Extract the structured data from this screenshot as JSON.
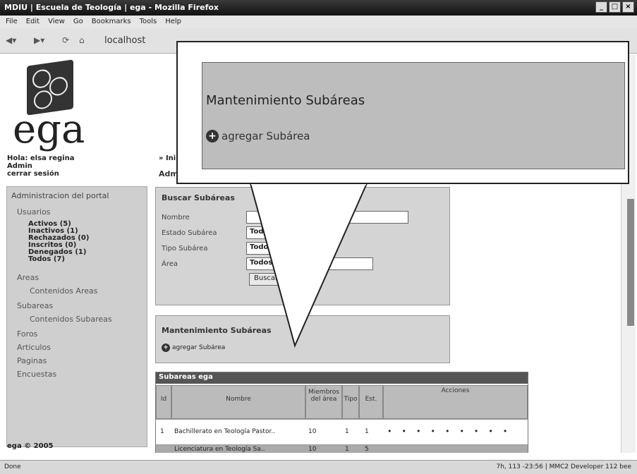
{
  "window": {
    "title": "MDIU | Escuela de Teología | ega - Mozilla Firefox"
  },
  "menu": [
    "File",
    "Edit",
    "View",
    "Go",
    "Bookmarks",
    "Tools",
    "Help"
  ],
  "nav": {
    "url": "localhost"
  },
  "logo": {
    "text": "ega"
  },
  "user": {
    "greeting": "Hola: elsa regina",
    "role": "Admin",
    "logout": "cerrar sesión"
  },
  "breadcrumb": "» Ini",
  "breadcrumb_section": "Adm",
  "sidebar": {
    "heading": "Administracion del portal",
    "usuarios": "Usuarios",
    "user_counts": [
      "Activos (5)",
      "Inactivos (1)",
      "Rechazados (0)",
      "Inscritos (0)",
      "Denegados (1)",
      "Todos (7)"
    ],
    "areas": "Areas",
    "contenidos_areas": "Contenidos Areas",
    "subareas": "Subareas",
    "contenidos_subareas": "Contenidos Subareas",
    "foros": "Foros",
    "articulos": "Articulos",
    "paginas": "Paginas",
    "encuestas": "Encuestas"
  },
  "search": {
    "title": "Buscar Subáreas",
    "fields": [
      "Nombre",
      "Estado Subárea",
      "Tipo Subárea",
      "Área"
    ],
    "selects": [
      "Todos",
      "Todos",
      "Todos"
    ],
    "button": "Buscar"
  },
  "maint": {
    "title": "Mantenimiento Subáreas",
    "add": "agregar Subárea"
  },
  "grid": {
    "title": "Subareas ega",
    "headers": [
      "Id",
      "Nombre",
      "Miembros del área",
      "Tipo",
      "Est.",
      "Acciones"
    ],
    "rows": [
      {
        "id": "1",
        "name": "Bachillerato en Teología Pastor..",
        "members": "10",
        "type": "1",
        "est": "1"
      },
      {
        "id": "",
        "name": "Licenciatura en Teología Sa..",
        "members": "10",
        "type": "1",
        "est": "5"
      }
    ]
  },
  "footer": "ega © 2005",
  "status": {
    "left": "Done",
    "right": "7h, 113 -23:56 | MMC2 Developer 112 bee"
  },
  "callout": {
    "title": "Mantenimiento Subáreas",
    "add": "agregar Subárea"
  }
}
